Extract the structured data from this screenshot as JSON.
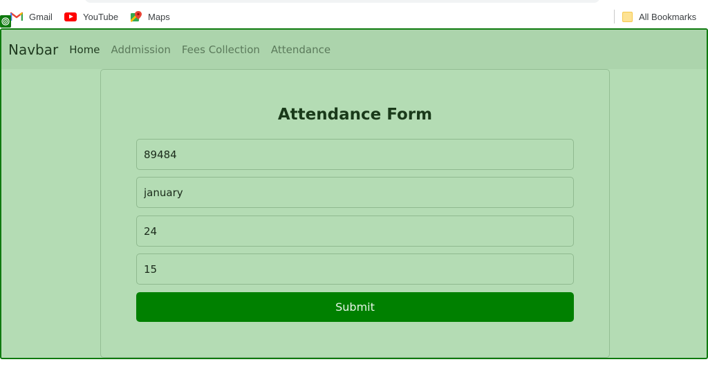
{
  "bookmarks": {
    "items": [
      {
        "label": "Gmail",
        "icon": "gmail-icon"
      },
      {
        "label": "YouTube",
        "icon": "youtube-icon"
      },
      {
        "label": "Maps",
        "icon": "maps-icon"
      }
    ],
    "all_bookmarks_label": "All Bookmarks"
  },
  "navbar": {
    "brand": "Navbar",
    "links": [
      "Home",
      "Addmission",
      "Fees Collection",
      "Attendance"
    ]
  },
  "form": {
    "title": "Attendance Form",
    "fields": [
      "89484",
      "january",
      "24",
      "15"
    ],
    "submit_label": "Submit"
  },
  "colors": {
    "page_background": "#b4dcb4",
    "navbar_background": "#acd4ac",
    "accent": "#008000",
    "frame_border": "#0e7a0e"
  }
}
